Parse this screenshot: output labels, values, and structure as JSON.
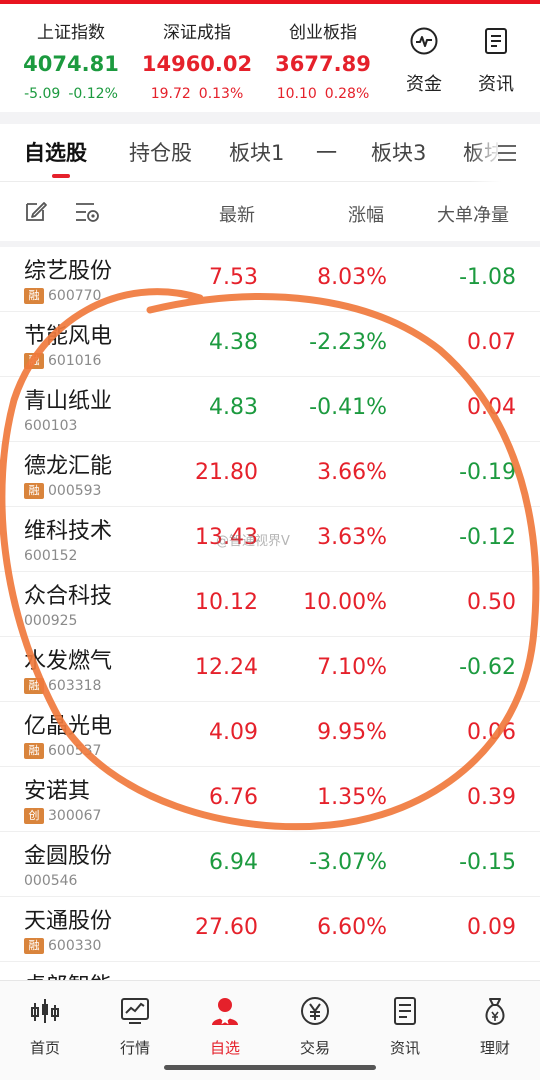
{
  "colors": {
    "accent": "#e5212b",
    "up": "#e5212b",
    "down": "#1c9a3f",
    "badge_rong": "#d9843c",
    "marker": "#f07a3d"
  },
  "indices": [
    {
      "name": "上证指数",
      "value": "4074.81",
      "change": "-5.09",
      "pct": "-0.12%",
      "direction": "down"
    },
    {
      "name": "深证成指",
      "value": "14960.02",
      "change": "19.72",
      "pct": "0.13%",
      "direction": "up"
    },
    {
      "name": "创业板指",
      "value": "3677.89",
      "change": "10.10",
      "pct": "0.28%",
      "direction": "up"
    }
  ],
  "header_buttons": [
    {
      "label": "资金",
      "icon": "pulse-chart-icon"
    },
    {
      "label": "资讯",
      "icon": "document-icon"
    }
  ],
  "tabs": [
    {
      "label": "自选股",
      "active": true
    },
    {
      "label": "持仓股",
      "active": false
    },
    {
      "label": "板块1",
      "active": false
    },
    {
      "label": "一",
      "active": false
    },
    {
      "label": "板块3",
      "active": false
    },
    {
      "label": "板块",
      "active": false
    }
  ],
  "columns": {
    "latest": "最新",
    "change": "涨幅",
    "net": "大单净量"
  },
  "stocks": [
    {
      "name": "综艺股份",
      "badge": "融",
      "code": "600770",
      "price": "7.53",
      "pct": "8.03%",
      "net": "-1.08",
      "price_dir": "up",
      "pct_dir": "up",
      "net_dir": "down"
    },
    {
      "name": "节能风电",
      "badge": "融",
      "code": "601016",
      "price": "4.38",
      "pct": "-2.23%",
      "net": "0.07",
      "price_dir": "down",
      "pct_dir": "down",
      "net_dir": "up"
    },
    {
      "name": "青山纸业",
      "badge": "",
      "code": "600103",
      "price": "4.83",
      "pct": "-0.41%",
      "net": "0.04",
      "price_dir": "down",
      "pct_dir": "down",
      "net_dir": "up"
    },
    {
      "name": "德龙汇能",
      "badge": "融",
      "code": "000593",
      "price": "21.80",
      "pct": "3.66%",
      "net": "-0.19",
      "price_dir": "up",
      "pct_dir": "up",
      "net_dir": "down"
    },
    {
      "name": "维科技术",
      "badge": "",
      "code": "600152",
      "price": "13.43",
      "pct": "3.63%",
      "net": "-0.12",
      "price_dir": "up",
      "pct_dir": "up",
      "net_dir": "down"
    },
    {
      "name": "众合科技",
      "badge": "",
      "code": "000925",
      "price": "10.12",
      "pct": "10.00%",
      "net": "0.50",
      "price_dir": "up",
      "pct_dir": "up",
      "net_dir": "up"
    },
    {
      "name": "水发燃气",
      "badge": "融",
      "code": "603318",
      "price": "12.24",
      "pct": "7.10%",
      "net": "-0.62",
      "price_dir": "up",
      "pct_dir": "up",
      "net_dir": "down"
    },
    {
      "name": "亿晶光电",
      "badge": "融",
      "code": "600537",
      "price": "4.09",
      "pct": "9.95%",
      "net": "0.06",
      "price_dir": "up",
      "pct_dir": "up",
      "net_dir": "up"
    },
    {
      "name": "安诺其",
      "badge": "创",
      "code": "300067",
      "price": "6.76",
      "pct": "1.35%",
      "net": "0.39",
      "price_dir": "up",
      "pct_dir": "up",
      "net_dir": "up"
    },
    {
      "name": "金圆股份",
      "badge": "",
      "code": "000546",
      "price": "6.94",
      "pct": "-3.07%",
      "net": "-0.15",
      "price_dir": "down",
      "pct_dir": "down",
      "net_dir": "down"
    },
    {
      "name": "天通股份",
      "badge": "融",
      "code": "600330",
      "price": "27.60",
      "pct": "6.60%",
      "net": "0.09",
      "price_dir": "up",
      "pct_dir": "up",
      "net_dir": "up"
    },
    {
      "name": "卓郎智能",
      "badge": "",
      "code": "",
      "price": "",
      "pct": "",
      "net": "",
      "price_dir": "up",
      "pct_dir": "up",
      "net_dir": "up"
    }
  ],
  "watermark": "@智通视界V",
  "bottom_nav": [
    {
      "label": "首页",
      "icon": "home-candlestick-icon",
      "active": false
    },
    {
      "label": "行情",
      "icon": "market-chart-icon",
      "active": false
    },
    {
      "label": "自选",
      "icon": "user-star-icon",
      "active": true
    },
    {
      "label": "交易",
      "icon": "yuan-coin-icon",
      "active": false
    },
    {
      "label": "资讯",
      "icon": "news-document-icon",
      "active": false
    },
    {
      "label": "理财",
      "icon": "money-bag-icon",
      "active": false
    }
  ]
}
